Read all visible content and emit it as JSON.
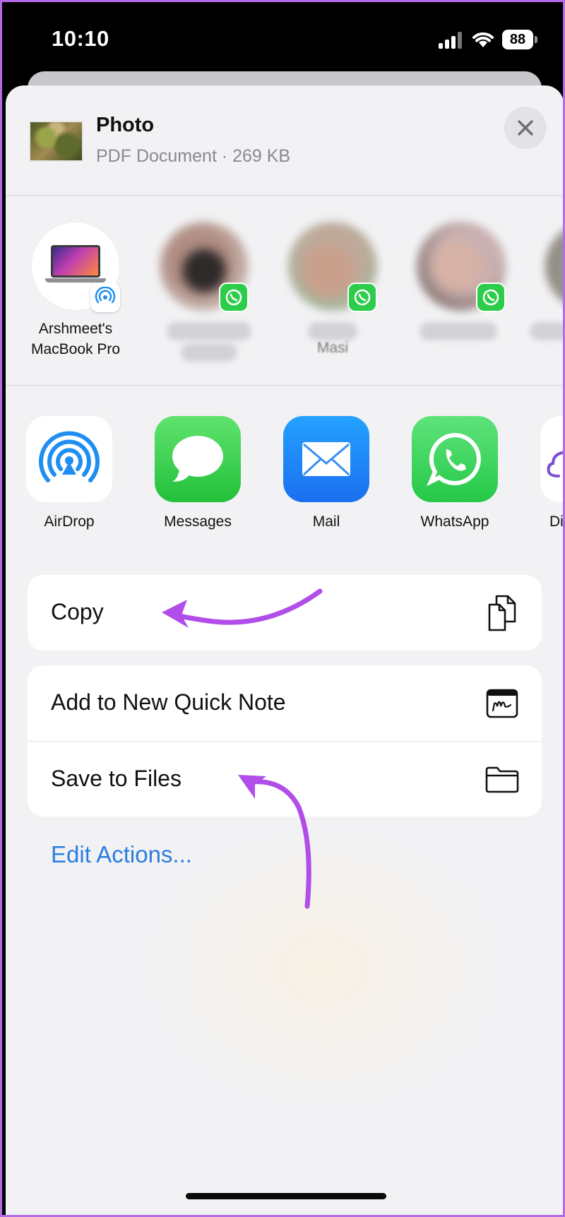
{
  "status_bar": {
    "time": "10:10",
    "battery": "88"
  },
  "header": {
    "title": "Photo",
    "subtitle": "PDF Document · 269 KB",
    "close_icon": "close-icon"
  },
  "people": [
    {
      "name_line1": "Arshmeet's",
      "name_line2": "MacBook Pro",
      "badge": "airdrop-icon"
    },
    {
      "name_line1": "",
      "name_line2": "",
      "badge": "whatsapp-icon"
    },
    {
      "name_line1": "",
      "name_line2": "Masi",
      "badge": "whatsapp-icon"
    },
    {
      "name_line1": "",
      "name_line2": "",
      "badge": "whatsapp-icon"
    }
  ],
  "apps": [
    {
      "label": "AirDrop",
      "icon": "airdrop-icon"
    },
    {
      "label": "Messages",
      "icon": "messages-icon"
    },
    {
      "label": "Mail",
      "icon": "mail-icon"
    },
    {
      "label": "WhatsApp",
      "icon": "whatsapp-icon"
    },
    {
      "label": "Dig",
      "icon": "cloud-icon"
    }
  ],
  "actions": {
    "copy": {
      "label": "Copy",
      "icon": "copy-icon"
    },
    "quick_note": {
      "label": "Add to New Quick Note",
      "icon": "quick-note-icon"
    },
    "save_files": {
      "label": "Save to Files",
      "icon": "folder-icon"
    }
  },
  "edit_actions": "Edit Actions...",
  "colors": {
    "accent": "#2a7ee0",
    "annotation_arrow": "#b14de8",
    "sheet_bg": "#f2f2f4",
    "frame_border": "#b46be6"
  }
}
